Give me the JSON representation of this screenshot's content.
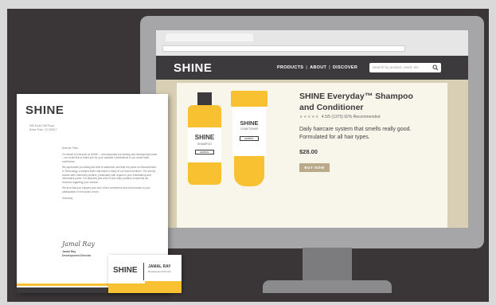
{
  "site": {
    "logo": "SHINE",
    "nav": {
      "products": "PRODUCTS",
      "about": "ABOUT",
      "discover": "DISCOVER",
      "separator": "|"
    },
    "search_placeholder": "Search by product, need, etc.",
    "search_icon": "search-icon"
  },
  "product": {
    "title": "SHINE Everyday™ Shampoo and Conditioner",
    "stars": "★★★★★",
    "rating_text": "4.5/5 (1375) 92% Recommended",
    "description": "Daily haircare system that smells really good. Formulated for all hair types.",
    "price": "$28.00",
    "buy_label": "BUY NOW"
  },
  "bottles": {
    "shampoo": {
      "brand": "SHINE",
      "type": "SHAMPOO",
      "tag": "HERBAL"
    },
    "conditioner": {
      "brand": "SHINE",
      "type": "CONDITIONER",
      "tag": "HERBAL"
    }
  },
  "letter": {
    "logo": "SHINE",
    "address_line1": "555 Solid Cliff Road",
    "address_line2": "Boise Park, CO 80517",
    "greeting": "Dear Mr. Park,",
    "para1": "On behalf of everyone at SHINE – and especially the training and development team – we would like to thank you for your valuable contributions to our recent staff conference.",
    "para2": "We appreciate you taking the time to assemble and lead the panel on Advancement in Technology, a subject that's important to many of our team members. The survey results were extremely positive, particularly with regard to your entertaining and informative panel. I've attached just a few of the many positive comments we received regarding your session.",
    "para3": "We trust that you enjoyed your time at the conference and look forward to your participation in next year's event.",
    "closing": "Sincerely,",
    "signature": "Jamal Ray",
    "signer_name": "Jamal Ray",
    "signer_title": "Development Director"
  },
  "card": {
    "logo": "SHINE",
    "name": "JAMAL RAY",
    "role": "Development Director"
  },
  "colors": {
    "brand_yellow": "#f8c132",
    "brand_dark": "#3c3a3c",
    "hero_tan": "#d9cfb4",
    "button_tan": "#b9ab8a"
  }
}
